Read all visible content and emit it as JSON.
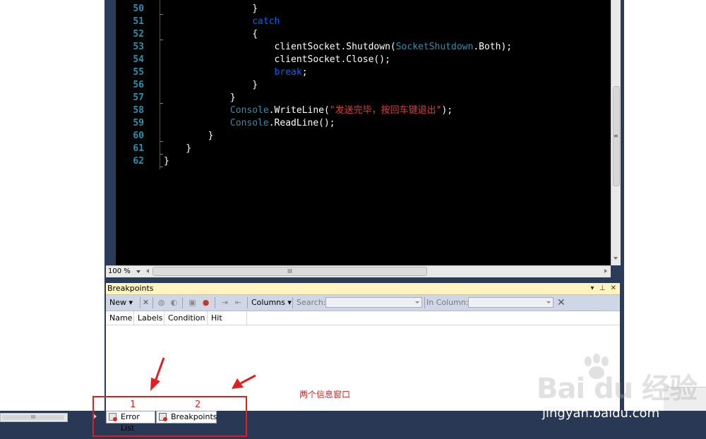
{
  "editor": {
    "lines": [
      {
        "num": "50",
        "parts": [
          {
            "t": "                }",
            "c": ""
          }
        ]
      },
      {
        "num": "51",
        "parts": [
          {
            "t": "                ",
            "c": ""
          },
          {
            "t": "catch",
            "c": "kw"
          }
        ]
      },
      {
        "num": "52",
        "parts": [
          {
            "t": "                {",
            "c": ""
          }
        ]
      },
      {
        "num": "53",
        "parts": [
          {
            "t": "                    clientSocket.Shutdown(",
            "c": ""
          },
          {
            "t": "SocketShutdown",
            "c": "ty"
          },
          {
            "t": ".Both);",
            "c": ""
          }
        ]
      },
      {
        "num": "54",
        "parts": [
          {
            "t": "                    clientSocket.Close();",
            "c": ""
          }
        ]
      },
      {
        "num": "55",
        "parts": [
          {
            "t": "                    ",
            "c": ""
          },
          {
            "t": "break",
            "c": "kw"
          },
          {
            "t": ";",
            "c": ""
          }
        ]
      },
      {
        "num": "56",
        "parts": [
          {
            "t": "                }",
            "c": ""
          }
        ]
      },
      {
        "num": "57",
        "parts": [
          {
            "t": "            }",
            "c": ""
          }
        ]
      },
      {
        "num": "58",
        "parts": [
          {
            "t": "            ",
            "c": ""
          },
          {
            "t": "Console",
            "c": "ty"
          },
          {
            "t": ".WriteLine(",
            "c": ""
          },
          {
            "t": "\"发送完毕，按回车键退出\"",
            "c": "str"
          },
          {
            "t": ");",
            "c": ""
          }
        ]
      },
      {
        "num": "59",
        "parts": [
          {
            "t": "            ",
            "c": ""
          },
          {
            "t": "Console",
            "c": "ty"
          },
          {
            "t": ".ReadLine();",
            "c": ""
          }
        ]
      },
      {
        "num": "60",
        "parts": [
          {
            "t": "        }",
            "c": ""
          }
        ]
      },
      {
        "num": "61",
        "parts": [
          {
            "t": "    }",
            "c": ""
          }
        ]
      },
      {
        "num": "62",
        "parts": [
          {
            "t": "}",
            "c": ""
          }
        ]
      }
    ],
    "zoom": "100 %",
    "scroll_grip": "III",
    "vscroll_grip": "≡",
    "left_scroll_grip": "III"
  },
  "breakpoints_panel": {
    "title": "Breakpoints",
    "window_controls": "▾ ⊥ ✕",
    "toolbar": {
      "new_label": "New",
      "columns_label": "Columns",
      "search_label": "Search:",
      "in_column_label": "In Column:",
      "clear_icon": "✕"
    },
    "columns": [
      "Name",
      "Labels",
      "Condition",
      "Hit Count"
    ]
  },
  "tabs": {
    "error_list": "Error List",
    "breakpoints": "Breakpoints"
  },
  "annotations": {
    "num1": "1",
    "num2": "2",
    "note": "两个信息窗口",
    "color": "#e02020"
  },
  "watermark": {
    "logo": "Bai du 经验",
    "url": "jingyan.baidu.com"
  },
  "colors": {
    "editor_bg": "#000000",
    "line_number": "#2b91af",
    "keyword": "#0066ff",
    "type": "#2b91af",
    "string": "#d64141",
    "ide_frame": "#2b3c59",
    "panel_title": "#fff4bf"
  }
}
